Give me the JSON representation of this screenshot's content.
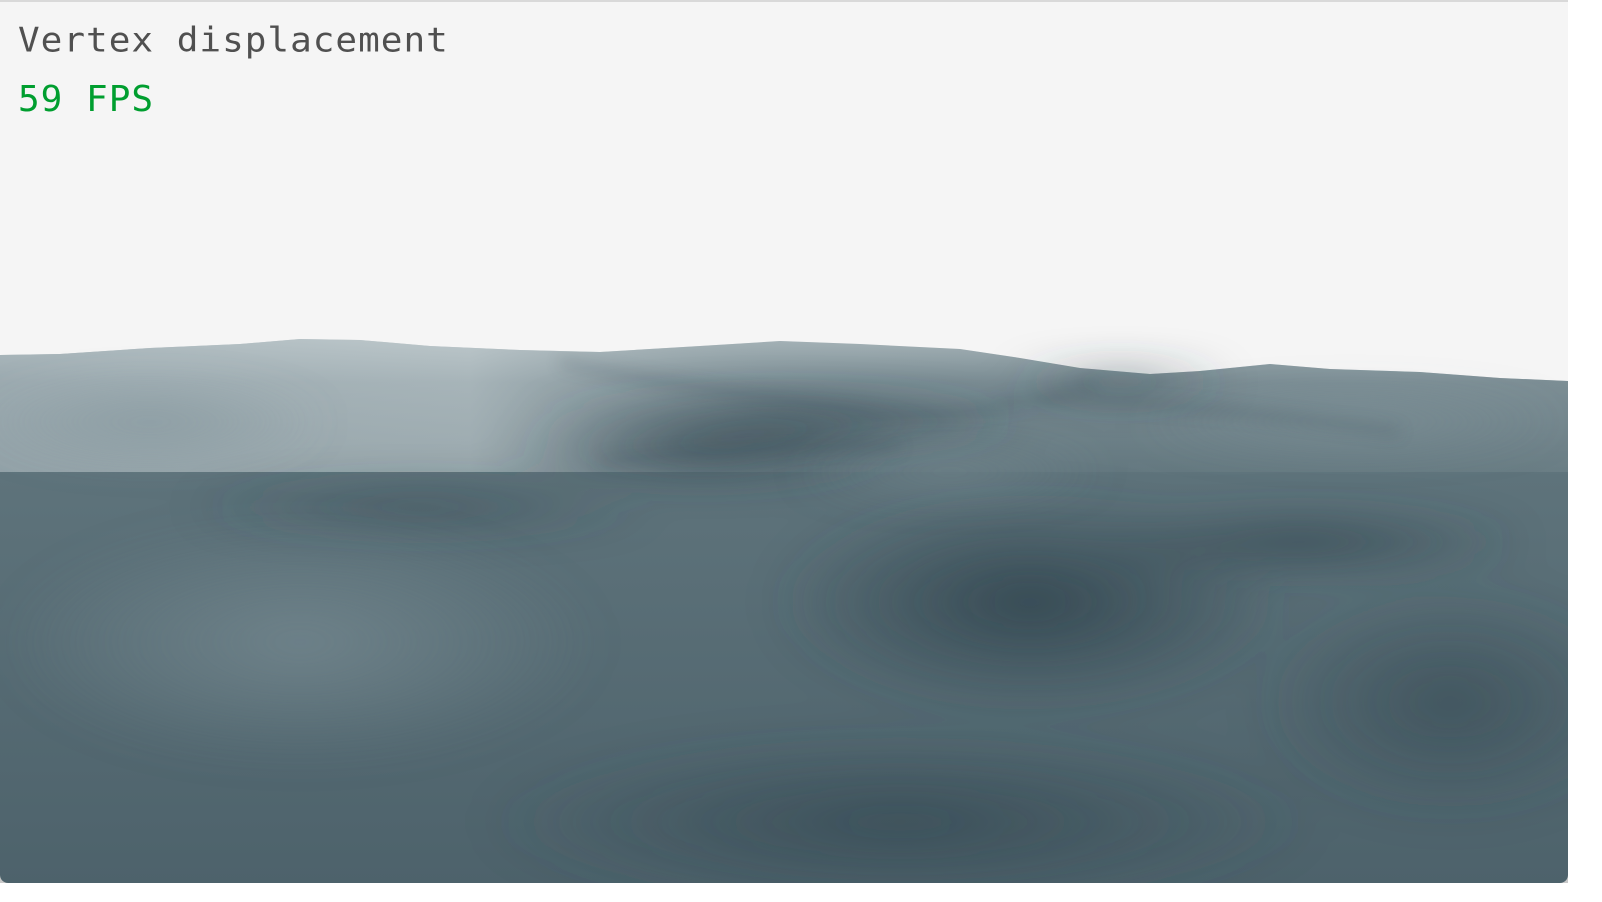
{
  "window": {
    "title": "Vertex displacement",
    "fps_label": "59 FPS"
  },
  "scene": {
    "description_name": "displaced-terrain-mesh",
    "colors": {
      "background": "#f5f5f5",
      "terrain_light": "#9aa9af",
      "terrain_mid": "#5b7077",
      "terrain_dark": "#354b55",
      "fps_text": "#009e2f",
      "title_text": "#505050"
    }
  }
}
